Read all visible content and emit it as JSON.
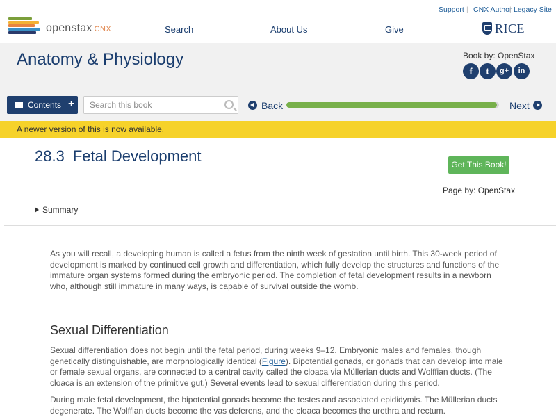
{
  "header": {
    "brand": "openstax",
    "brand_suffix": "CNX",
    "nav": [
      "Search",
      "About Us",
      "Give"
    ],
    "utility": [
      "Support",
      "CNX Author",
      "Legacy Site"
    ],
    "rice_logo": "RICE",
    "logo_colors": [
      "#7b9f3b",
      "#f3b234",
      "#e8843f",
      "#3a8fc4",
      "#2b3a6b"
    ]
  },
  "book": {
    "title": "Anatomy & Physiology",
    "book_by": "Book by: OpenStax",
    "social": [
      {
        "icon": "facebook-icon",
        "glyph": "f"
      },
      {
        "icon": "twitter-icon",
        "glyph": "t"
      },
      {
        "icon": "google-plus-icon",
        "glyph": "g+"
      },
      {
        "icon": "linkedin-icon",
        "glyph": "in"
      }
    ]
  },
  "toolbar": {
    "contents_label": "Contents",
    "search_placeholder": "Search this book",
    "back_label": "Back",
    "next_label": "Next",
    "progress": 0.99
  },
  "notice": {
    "prefix": "A ",
    "link": "newer version",
    "suffix": " of this is now available."
  },
  "section": {
    "number": "28.3",
    "title": "Fetal Development",
    "get_book": "Get This Book!",
    "page_by": "Page by: OpenStax",
    "summary": "Summary"
  },
  "content": {
    "intro": "As you will recall, a developing human is called a fetus from the ninth week of gestation until birth. This 30-week period of development is marked by continued cell growth and differentiation, which fully develop the structures and functions of the immature organ systems formed during the embryonic period. The completion of fetal development results in a newborn who, although still immature in many ways, is capable of survival outside the womb.",
    "heading": "Sexual Differentiation",
    "p1_a": "Sexual differentiation does not begin until the fetal period, during weeks 9–12. Embryonic males and females, though genetically distinguishable, are morphologically identical (",
    "p1_link": "Figure",
    "p1_b": "). Bipotential gonads, or gonads that can develop into male or female sexual organs, are connected to a central cavity called the cloaca via Müllerian ducts and Wolffian ducts. (The cloaca is an extension of the primitive gut.) Several events lead to sexual differentiation during this period.",
    "p2": "During male fetal development, the bipotential gonads become the testes and associated epididymis. The Müllerian ducts degenerate. The Wolffian ducts become the vas deferens, and the cloaca becomes the urethra and rectum."
  }
}
